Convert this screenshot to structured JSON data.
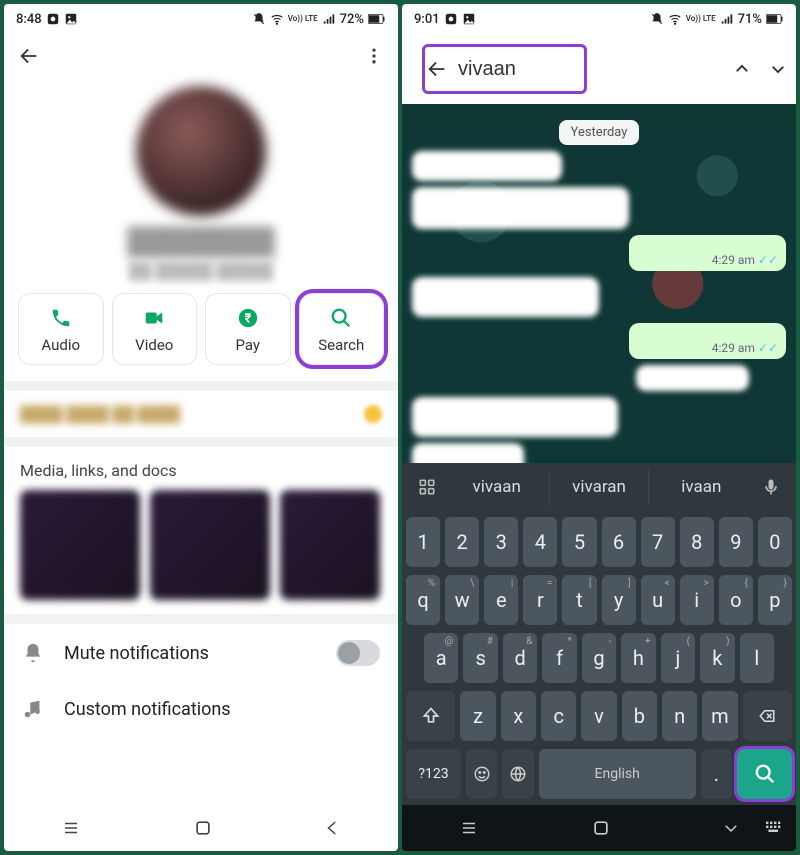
{
  "left": {
    "statusbar": {
      "time": "8:48",
      "battery": "72%",
      "net_label": "Vo)) LTE"
    },
    "actions": {
      "audio": "Audio",
      "video": "Video",
      "pay": "Pay",
      "search": "Search"
    },
    "media_header": "Media, links, and docs",
    "settings": {
      "mute": "Mute notifications",
      "custom": "Custom notifications"
    }
  },
  "right": {
    "statusbar": {
      "time": "9:01",
      "battery": "71%",
      "net_label": "Vo)) LTE"
    },
    "search_value": "vivaan",
    "date_label": "Yesterday",
    "msg_time": "4:29 am",
    "suggestions": {
      "s1": "vivaan",
      "s2": "vivaran",
      "s3": "ivaan"
    },
    "keyboard": {
      "row_num": [
        "1",
        "2",
        "3",
        "4",
        "5",
        "6",
        "7",
        "8",
        "9",
        "0"
      ],
      "row_q": [
        "q",
        "w",
        "e",
        "r",
        "t",
        "y",
        "u",
        "i",
        "o",
        "p"
      ],
      "row_q_sup": [
        "%",
        "\\",
        "|",
        "=",
        "[",
        "]",
        "<",
        ">",
        "{",
        "}"
      ],
      "row_a": [
        "a",
        "s",
        "d",
        "f",
        "g",
        "h",
        "j",
        "k",
        "l"
      ],
      "row_a_sup": [
        "@",
        "#",
        "&",
        "*",
        "-",
        "+",
        "(",
        ")",
        ""
      ],
      "row_z": [
        "z",
        "x",
        "c",
        "v",
        "b",
        "n",
        "m"
      ],
      "sym": "?123",
      "space": "English",
      "period": "."
    }
  }
}
